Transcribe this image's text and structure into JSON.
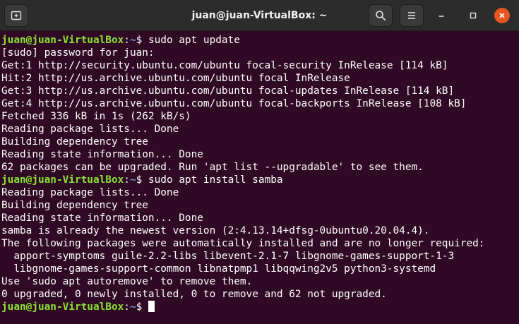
{
  "window": {
    "title": "juan@juan-VirtualBox: ~",
    "icons": {
      "new_tab": "new-tab-icon",
      "search": "search-icon",
      "menu": "hamburger-menu-icon",
      "minimize": "minimize-icon",
      "maximize": "maximize-icon",
      "close": "close-icon"
    },
    "colors": {
      "background": "#300a24",
      "prompt_user": "#8ae234",
      "prompt_path": "#729fcf",
      "close_button": "#e95420"
    }
  },
  "terminal": {
    "prompt": {
      "user_host": "juan@juan-VirtualBox",
      "colon": ":",
      "path": "~",
      "symbol": "$ "
    },
    "lines": [
      {
        "type": "prompt",
        "cmd": "sudo apt update"
      },
      {
        "type": "text",
        "text": "[sudo] password for juan:"
      },
      {
        "type": "text",
        "text": "Get:1 http://security.ubuntu.com/ubuntu focal-security InRelease [114 kB]"
      },
      {
        "type": "text",
        "text": "Hit:2 http://us.archive.ubuntu.com/ubuntu focal InRelease"
      },
      {
        "type": "text",
        "text": "Get:3 http://us.archive.ubuntu.com/ubuntu focal-updates InRelease [114 kB]"
      },
      {
        "type": "text",
        "text": "Get:4 http://us.archive.ubuntu.com/ubuntu focal-backports InRelease [108 kB]"
      },
      {
        "type": "text",
        "text": "Fetched 336 kB in 1s (262 kB/s)"
      },
      {
        "type": "text",
        "text": "Reading package lists... Done"
      },
      {
        "type": "text",
        "text": "Building dependency tree"
      },
      {
        "type": "text",
        "text": "Reading state information... Done"
      },
      {
        "type": "text",
        "text": "62 packages can be upgraded. Run 'apt list --upgradable' to see them."
      },
      {
        "type": "prompt",
        "cmd": "sudo apt install samba"
      },
      {
        "type": "text",
        "text": "Reading package lists... Done"
      },
      {
        "type": "text",
        "text": "Building dependency tree"
      },
      {
        "type": "text",
        "text": "Reading state information... Done"
      },
      {
        "type": "text",
        "text": "samba is already the newest version (2:4.13.14+dfsg-0ubuntu0.20.04.4)."
      },
      {
        "type": "text",
        "text": "The following packages were automatically installed and are no longer required:"
      },
      {
        "type": "text",
        "text": "  apport-symptoms guile-2.2-libs libevent-2.1-7 libgnome-games-support-1-3"
      },
      {
        "type": "text",
        "text": "  libgnome-games-support-common libnatpmp1 libqqwing2v5 python3-systemd"
      },
      {
        "type": "text",
        "text": "Use 'sudo apt autoremove' to remove them."
      },
      {
        "type": "text",
        "text": "0 upgraded, 0 newly installed, 0 to remove and 62 not upgraded."
      },
      {
        "type": "prompt",
        "cmd": "",
        "cursor": true
      }
    ]
  }
}
